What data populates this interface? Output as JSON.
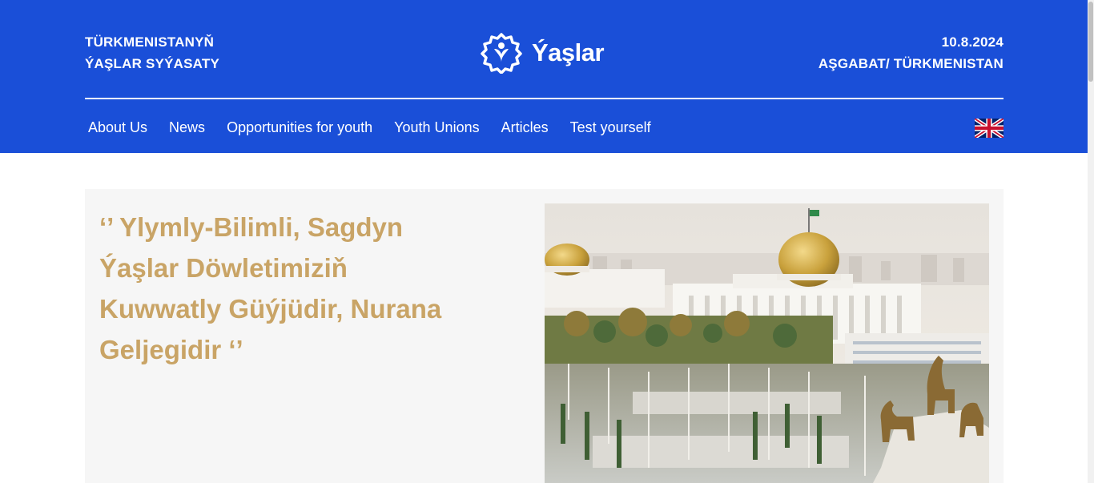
{
  "header": {
    "left_line1": "TÜRKMENISTANYŇ",
    "left_line2": "ÝAŞLAR SYÝASATY",
    "right_line1": "10.8.2024",
    "right_line2": "AŞGABAT/ TÜRKMENISTAN",
    "logo_text": "Ýaşlar"
  },
  "nav": {
    "items": [
      {
        "label": "About Us"
      },
      {
        "label": "News"
      },
      {
        "label": "Opportunities for youth"
      },
      {
        "label": "Youth Unions"
      },
      {
        "label": "Articles"
      },
      {
        "label": "Test yourself"
      }
    ],
    "language_flag": "uk-flag-icon"
  },
  "hero": {
    "quote": "‘’ Ylymly-Bilimli, Sagdyn Ýaşlar Döwletimiziň Kuwwatly Güýjüdir, Nurana Geljegidir ‘’"
  },
  "colors": {
    "header_bg": "#1a4fd8",
    "quote_gold": "#c9a466",
    "hero_bg": "#f6f6f6"
  }
}
